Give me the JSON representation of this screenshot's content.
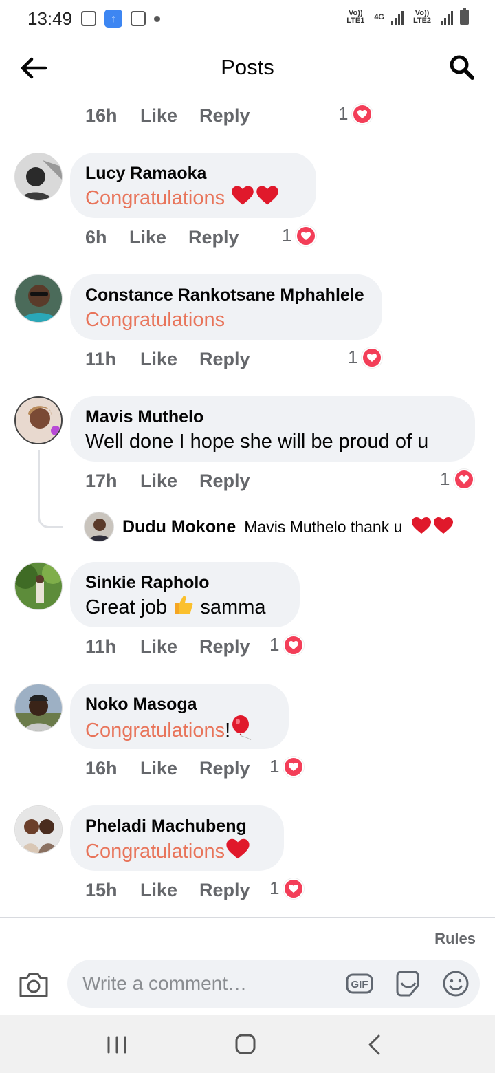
{
  "status_bar": {
    "time": "13:49",
    "sim1": "Vo)) LTE1",
    "network": "4G",
    "sim2": "Vo)) LTE2"
  },
  "header": {
    "title": "Posts",
    "back_icon": "arrow-left-icon",
    "search_icon": "search-icon"
  },
  "actions": {
    "like": "Like",
    "reply": "Reply"
  },
  "top_meta": {
    "time": "16h",
    "reaction_count": "1"
  },
  "comments": [
    {
      "author": "Lucy Ramaoka",
      "text": "Congratulations",
      "time": "6h",
      "reaction_count": "1"
    },
    {
      "author": "Constance Rankotsane Mphahlele",
      "text": "Congratulations",
      "time": "11h",
      "reaction_count": "1"
    },
    {
      "author": "Mavis Muthelo",
      "text": "Well done I hope she will be proud of u",
      "time": "17h",
      "reaction_count": "1",
      "reply": {
        "author": "Dudu Mokone",
        "text": "Mavis Muthelo thank u"
      }
    },
    {
      "author": "Sinkie Rapholo",
      "text_before": "Great job",
      "text_after": "samma",
      "time": "11h",
      "reaction_count": "1"
    },
    {
      "author": "Noko Masoga",
      "text": "Congratulations",
      "suffix": "!",
      "time": "16h",
      "reaction_count": "1"
    },
    {
      "author": "Pheladi Machubeng",
      "text": "Congratulations",
      "time": "15h",
      "reaction_count": "1"
    }
  ],
  "composer": {
    "rules": "Rules",
    "placeholder": "Write a comment…",
    "gif_label": "GIF"
  },
  "colors": {
    "highlight_text": "#e8745a",
    "bubble": "#f0f2f5",
    "reaction": "#f33e58"
  }
}
